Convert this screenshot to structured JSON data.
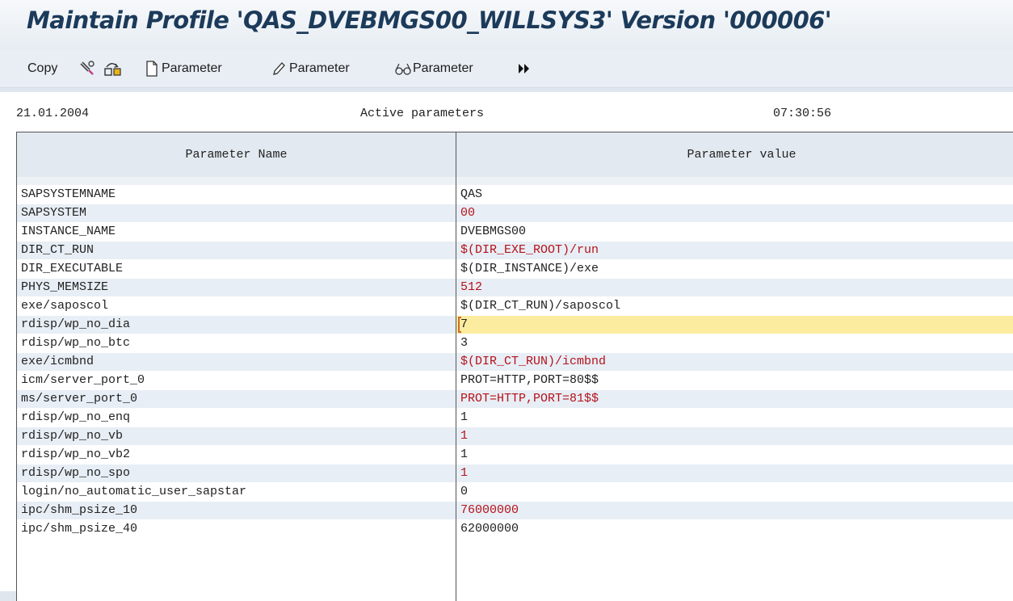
{
  "window": {
    "title": "Maintain Profile 'QAS_DVEBMGS00_WILLSYS3' Version '000006'"
  },
  "toolbar": {
    "copy_label": "Copy",
    "create_parameter_label": "Parameter",
    "change_parameter_label": "Parameter",
    "display_parameter_label": "Parameter"
  },
  "header": {
    "date": "21.01.2004",
    "status": "Active parameters",
    "time": "07:30:56"
  },
  "table": {
    "columns": [
      "Parameter Name",
      "Parameter value"
    ],
    "rows": [
      {
        "name": "SAPSYSTEMNAME",
        "value": "QAS",
        "changed": false
      },
      {
        "name": "SAPSYSTEM",
        "value": "00",
        "changed": true
      },
      {
        "name": "INSTANCE_NAME",
        "value": "DVEBMGS00",
        "changed": false
      },
      {
        "name": "DIR_CT_RUN",
        "value": "$(DIR_EXE_ROOT)/run",
        "changed": true
      },
      {
        "name": "DIR_EXECUTABLE",
        "value": "$(DIR_INSTANCE)/exe",
        "changed": false
      },
      {
        "name": "PHYS_MEMSIZE",
        "value": "512",
        "changed": true
      },
      {
        "name": "exe/saposcol",
        "value": "$(DIR_CT_RUN)/saposcol",
        "changed": false
      },
      {
        "name": "rdisp/wp_no_dia",
        "value": "7",
        "changed": false,
        "selected": true
      },
      {
        "name": "rdisp/wp_no_btc",
        "value": "3",
        "changed": false
      },
      {
        "name": "exe/icmbnd",
        "value": "$(DIR_CT_RUN)/icmbnd",
        "changed": true
      },
      {
        "name": "icm/server_port_0",
        "value": "PROT=HTTP,PORT=80$$",
        "changed": false
      },
      {
        "name": "ms/server_port_0",
        "value": "PROT=HTTP,PORT=81$$",
        "changed": true
      },
      {
        "name": "rdisp/wp_no_enq",
        "value": "1",
        "changed": false
      },
      {
        "name": "rdisp/wp_no_vb",
        "value": "1",
        "changed": true
      },
      {
        "name": "rdisp/wp_no_vb2",
        "value": "1",
        "changed": false
      },
      {
        "name": "rdisp/wp_no_spo",
        "value": "1",
        "changed": true
      },
      {
        "name": "login/no_automatic_user_sapstar",
        "value": "0",
        "changed": false
      },
      {
        "name": "ipc/shm_psize_10",
        "value": "76000000",
        "changed": true
      },
      {
        "name": "ipc/shm_psize_40",
        "value": "62000000",
        "changed": false
      }
    ]
  },
  "colors": {
    "title": "#1c3a5a",
    "changed_value": "#b5121b",
    "selected_row": "#fbeca0",
    "alt_row": "#e8eef5"
  },
  "icons": [
    "copy-icon",
    "tools-icon",
    "transport-icon",
    "create-icon",
    "pencil-icon",
    "glasses-icon",
    "more-icon"
  ]
}
